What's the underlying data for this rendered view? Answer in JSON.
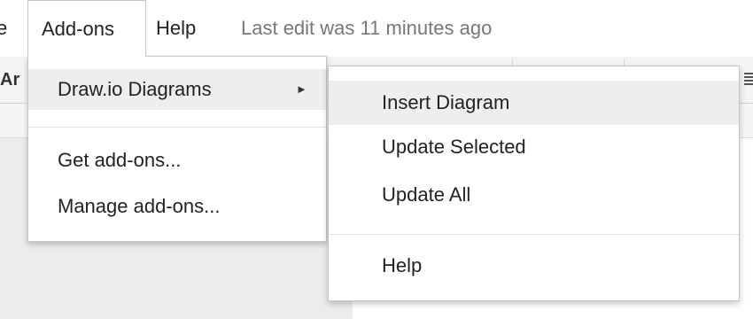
{
  "menubar": {
    "partial_left": "e",
    "addons": "Add-ons",
    "help": "Help",
    "status": "Last edit was 11 minutes ago"
  },
  "toolbar": {
    "font_fragment": "Ar"
  },
  "addons_menu": {
    "items": [
      {
        "label": "Draw.io Diagrams",
        "has_submenu": true,
        "arrow": "►",
        "highlighted": true
      },
      {
        "label": "Get add-ons...",
        "has_submenu": false
      },
      {
        "label": "Manage add-ons...",
        "has_submenu": false
      }
    ]
  },
  "drawio_submenu": {
    "items": [
      {
        "label": "Insert Diagram",
        "highlighted": true
      },
      {
        "label": "Update Selected"
      },
      {
        "label": "Update All"
      },
      {
        "label": "Help"
      }
    ]
  },
  "colors": {
    "highlight": "#eeeeee",
    "status_text": "#777777",
    "border": "#c6c6c6"
  }
}
